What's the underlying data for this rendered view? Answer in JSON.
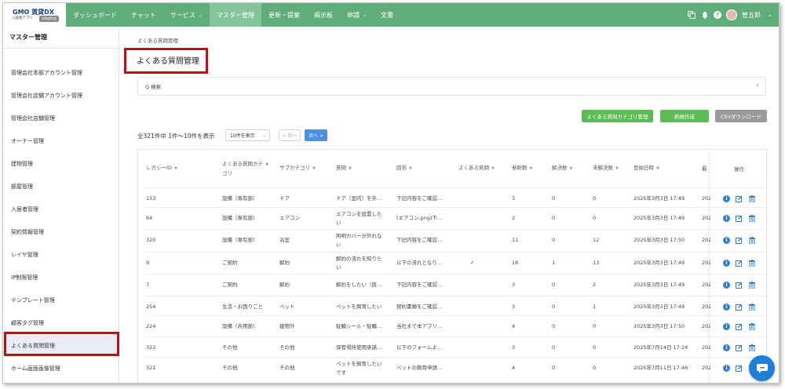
{
  "logo": {
    "brand": "GMO 賃貸DX",
    "subtitle": "入居者アプリ",
    "badge": "staging"
  },
  "nav": {
    "items": [
      {
        "label": "ダッシュボード",
        "chevron": false,
        "active": false
      },
      {
        "label": "チャット",
        "chevron": false,
        "active": false
      },
      {
        "label": "サービス",
        "chevron": true,
        "active": false
      },
      {
        "label": "マスター管理",
        "chevron": false,
        "active": true
      },
      {
        "label": "更新・提案",
        "chevron": false,
        "active": false
      },
      {
        "label": "掲示板",
        "chevron": false,
        "active": false
      },
      {
        "label": "申請",
        "chevron": true,
        "active": false
      },
      {
        "label": "文書",
        "chevron": false,
        "active": false
      }
    ],
    "user_name": "管五郎",
    "help_glyph": "?"
  },
  "sidebar": {
    "title": "マスター管理",
    "items": [
      "管理会社本部アカウント管理",
      "管理会社店舗アカウント管理",
      "管理会社店舗管理",
      "オーナー管理",
      "建物管理",
      "部屋管理",
      "入居者管理",
      "契約情報管理",
      "レイヤ管理",
      "IP制限管理",
      "テンプレート管理",
      "顧客タグ管理",
      "よくある質問管理",
      "ホーム画面画像管理"
    ],
    "active_index": 12
  },
  "main": {
    "breadcrumb": "よくある質問管理",
    "title": "よくある質問管理",
    "search_label": "Q 検索",
    "buttons": {
      "category": "よくある質問カテゴリ管理",
      "new": "新規作成",
      "csv": "CSVダウンロード"
    },
    "count_text": "全321件中 1件〜10件を表示",
    "per_page": "10件を表示",
    "prev": "< 前へ",
    "next": "次へ >"
  },
  "table": {
    "columns": [
      {
        "label": "レガシーID",
        "label2": ""
      },
      {
        "label": "よくある質問カテ",
        "label2": "ゴリ"
      },
      {
        "label": "サブカテゴリ",
        "label2": ""
      },
      {
        "label": "質問",
        "label2": ""
      },
      {
        "label": "回答",
        "label2": ""
      },
      {
        "label": "よくある質問",
        "label2": ""
      },
      {
        "label": "参照数",
        "label2": ""
      },
      {
        "label": "解決数",
        "label2": ""
      },
      {
        "label": "未解決数",
        "label2": ""
      },
      {
        "label": "登録日時",
        "label2": ""
      },
      {
        "label": "最",
        "label2": ""
      }
    ],
    "ops_header": "操作",
    "rows": [
      {
        "id": "153",
        "cat": "設備（専有部）",
        "sub": "ドア",
        "q1": "ドア（室内）を外…",
        "q2": "",
        "a": "下記内容をご確認…",
        "faq": "",
        "ref": "3",
        "solved": "0",
        "unsolved": "0",
        "date": "2025年3月3日 17:49",
        "last": "202"
      },
      {
        "id": "64",
        "cat": "設備（専有部）",
        "sub": "エアコン",
        "q1": "エアコンを設置した",
        "q2": "い",
        "a": "(エアコン.png)下…",
        "faq": "",
        "ref": "2",
        "solved": "0",
        "unsolved": "0",
        "date": "2025年3月3日 17:49",
        "last": "202"
      },
      {
        "id": "320",
        "cat": "設備（専有部）",
        "sub": "浴室",
        "q1": "照明カバーが外れな",
        "q2": "い",
        "a": "下記内容をご確認…",
        "faq": "",
        "ref": "11",
        "solved": "0",
        "unsolved": "12",
        "date": "2025年3月3日 17:50",
        "last": "202"
      },
      {
        "id": "9",
        "cat": "ご契約",
        "sub": "解約",
        "q1": "解約の流れを知りた",
        "q2": "い",
        "a": "以下の流れとなり…",
        "faq": "✓",
        "ref": "16",
        "solved": "1",
        "unsolved": "13",
        "date": "2025年3月3日 17:49",
        "last": "202"
      },
      {
        "id": "7",
        "cat": "ご契約",
        "sub": "解約",
        "q1": "解約をしたい（仮…",
        "q2": "",
        "a": "下記内容をご確認…",
        "faq": "",
        "ref": "3",
        "solved": "0",
        "unsolved": "2",
        "date": "2025年3月3日 17:49",
        "last": "202"
      },
      {
        "id": "254",
        "cat": "生活・お困りごと",
        "sub": "ペット",
        "q1": "ペットを飼育したい",
        "q2": "",
        "a": "契約書類をご確認…",
        "faq": "",
        "ref": "3",
        "solved": "0",
        "unsolved": "1",
        "date": "2025年3月3日 17:49",
        "last": "202"
      },
      {
        "id": "224",
        "cat": "設備（共用部）",
        "sub": "建物外",
        "q1": "駐輪シール・駐輪…",
        "q2": "",
        "a": "当社まで本アプリ…",
        "faq": "",
        "ref": "4",
        "solved": "0",
        "unsolved": "0",
        "date": "2025年3月3日 17:50",
        "last": "202"
      },
      {
        "id": "322",
        "cat": "その他",
        "sub": "その他",
        "q1": "保管場所使用承諾…",
        "q2": "",
        "a": "以下のフォームよ…",
        "faq": "",
        "ref": "3",
        "solved": "0",
        "unsolved": "0",
        "date": "2025年7月14日 17:24",
        "last": "202"
      },
      {
        "id": "321",
        "cat": "その他",
        "sub": "その他",
        "q1": "ペットを飼育したい",
        "q2": "です",
        "a": "ペットの飼育申請…",
        "faq": "",
        "ref": "4",
        "solved": "0",
        "unsolved": "0",
        "date": "2025年7月11日 17:46",
        "last": "202"
      }
    ]
  },
  "colors": {
    "nav_green": "#5fae7a",
    "button_green": "#5dbb52",
    "csv_gray": "#9a9a9a",
    "next_blue": "#4a8fe0",
    "highlight_red": "#c30d12",
    "info_blue": "#2f7fd6",
    "chat_blue": "#1d7fd8"
  },
  "icons": [
    "copy-icon",
    "bell-icon",
    "help-icon",
    "chevron-down-icon",
    "search-icon",
    "chevron-right-icon",
    "sort-arrow-icon",
    "info-icon",
    "edit-icon",
    "trash-icon",
    "chat-icon"
  ]
}
